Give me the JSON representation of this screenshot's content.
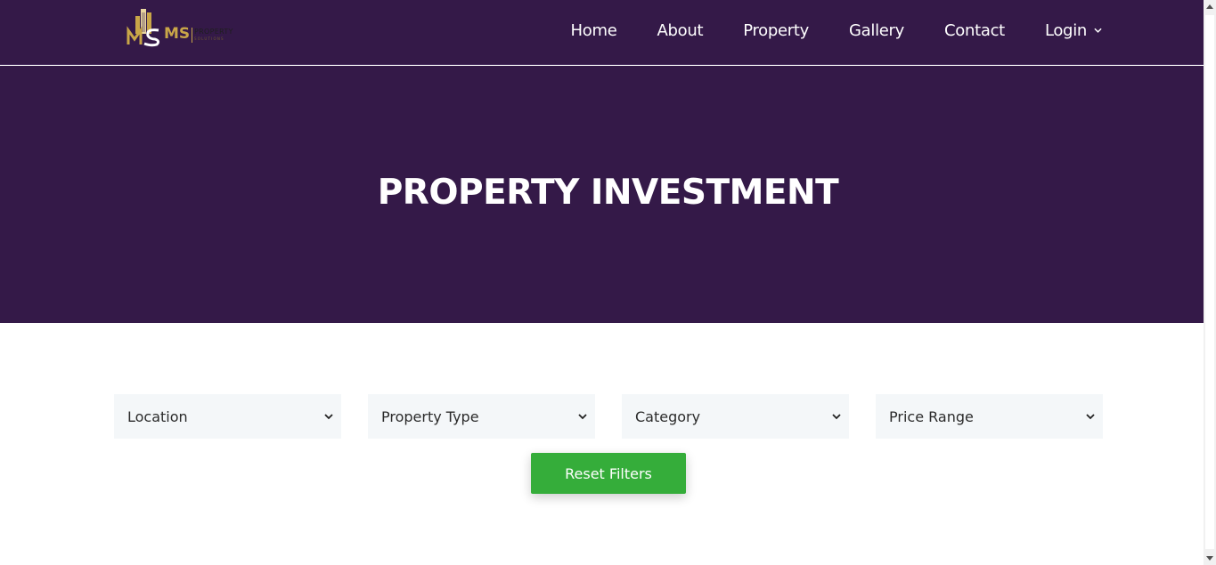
{
  "brand": {
    "logo_text": "MS",
    "logo_subtext": "PROPERTY",
    "logo_tagline": "SOLUTIONS",
    "colors": {
      "gold": "#c9a648",
      "header_bg": "#341948"
    }
  },
  "nav": {
    "items": [
      {
        "label": "Home"
      },
      {
        "label": "About"
      },
      {
        "label": "Property"
      },
      {
        "label": "Gallery"
      },
      {
        "label": "Contact"
      },
      {
        "label": "Login",
        "icon": "chevron-down-icon"
      }
    ]
  },
  "hero": {
    "title": "PROPERTY INVESTMENT"
  },
  "filters": {
    "location": "Location",
    "property_type": "Property Type",
    "category": "Category",
    "price_range": "Price Range"
  },
  "reset_button": {
    "label": "Reset Filters",
    "color": "#35ad3a"
  }
}
